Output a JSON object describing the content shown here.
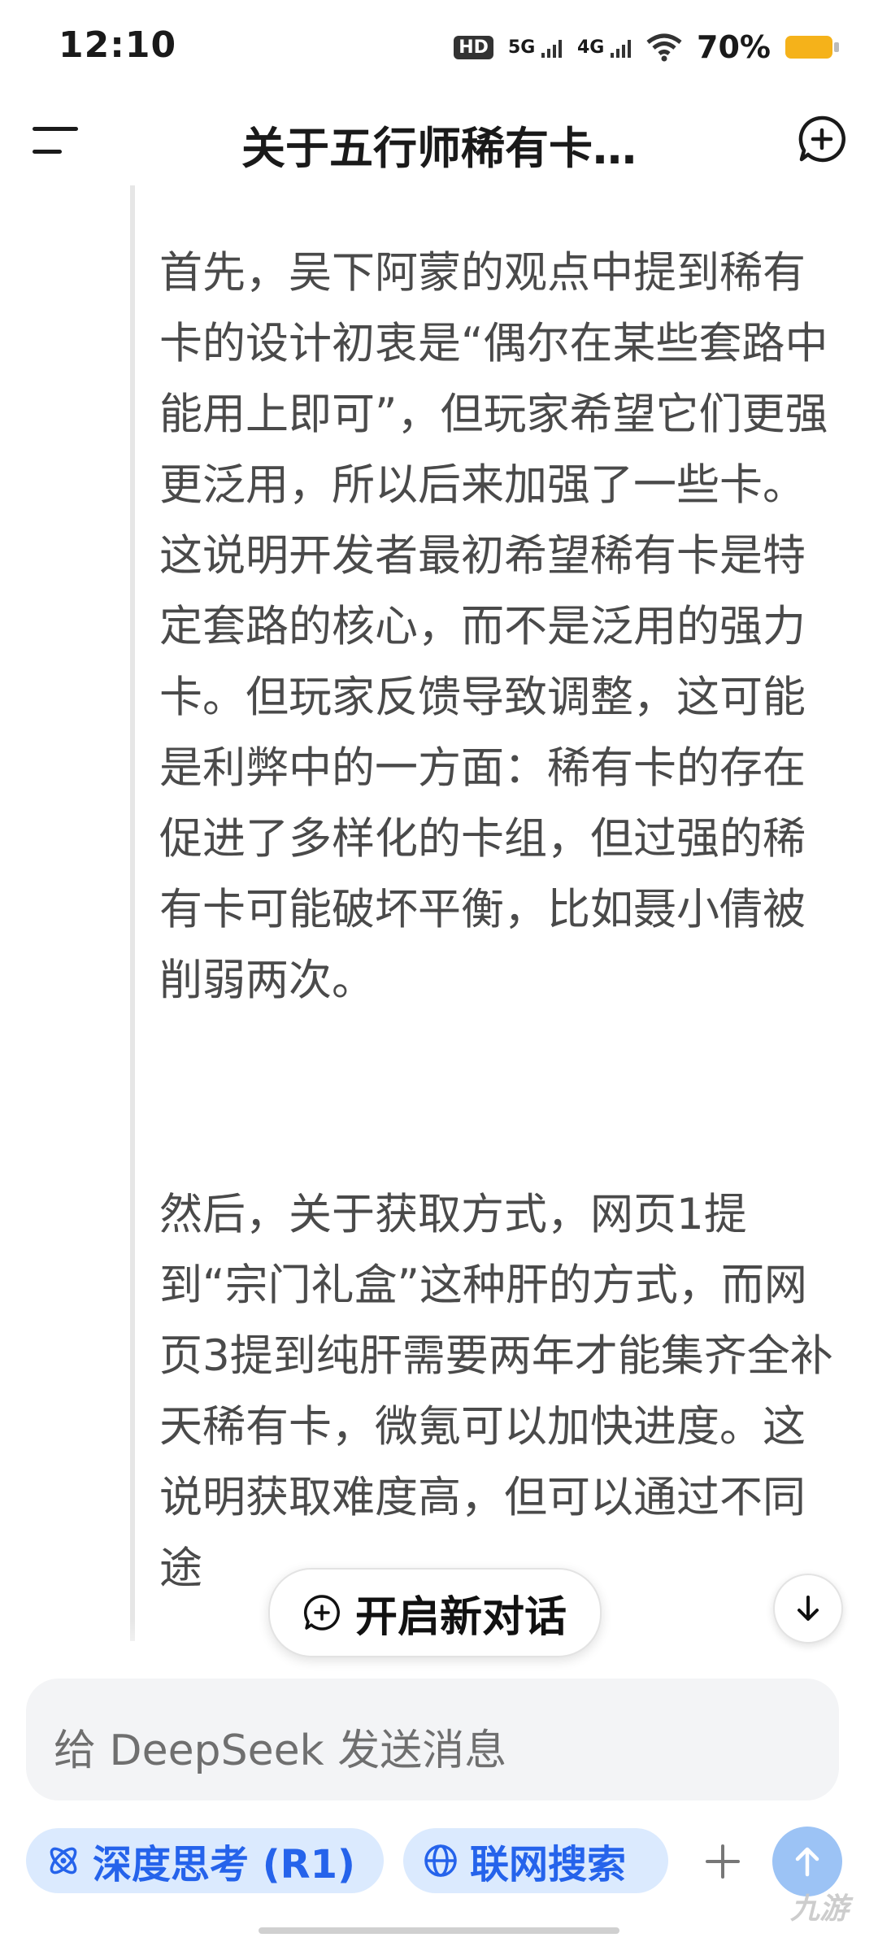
{
  "status_bar": {
    "time": "12:10",
    "hd": "HD",
    "sim1": "5G",
    "sim2": "4G",
    "battery_text": "70%",
    "battery_level": 0.7,
    "battery_color": "#f5b21a"
  },
  "header": {
    "title": "关于五行师稀有卡…",
    "menu_icon": "menu-icon",
    "new_chat_icon": "new-chat-icon"
  },
  "content": {
    "paragraph1": "首先，吴下阿蒙的观点中提到稀有卡的设计初衷是“偶尔在某些套路中能用上即可”，但玩家希望它们更强更泛用，所以后来加强了一些卡。这说明开发者最初希望稀有卡是特定套路的核心，而不是泛用的强力卡。但玩家反馈导致调整，这可能是利弊中的一方面：稀有卡的存在促进了多样化的卡组，但过强的稀有卡可能破坏平衡，比如聂小倩被削弱两次。",
    "paragraph2": "然后，关于获取方式，网页1提到“宗门礼盒”这种肝的方式，而网页3提到纯肝需要两年才能集齐全补天稀有卡，微氪可以加快进度。这说明获取难度高，但可以通过不同途"
  },
  "floating": {
    "new_dialog_label": "开启新对话",
    "scroll_down_icon": "arrow-down-icon"
  },
  "input": {
    "placeholder": "给 DeepSeek 发送消息"
  },
  "toolbar": {
    "deep_think_label": "深度思考 (R1)",
    "web_search_label": "联网搜索",
    "plus_icon": "plus-icon",
    "send_icon": "arrow-up-icon",
    "accent_color": "#2563eb",
    "chip_bg": "#dbeafe",
    "send_bg": "#9cc3f5"
  },
  "watermark": "九游"
}
